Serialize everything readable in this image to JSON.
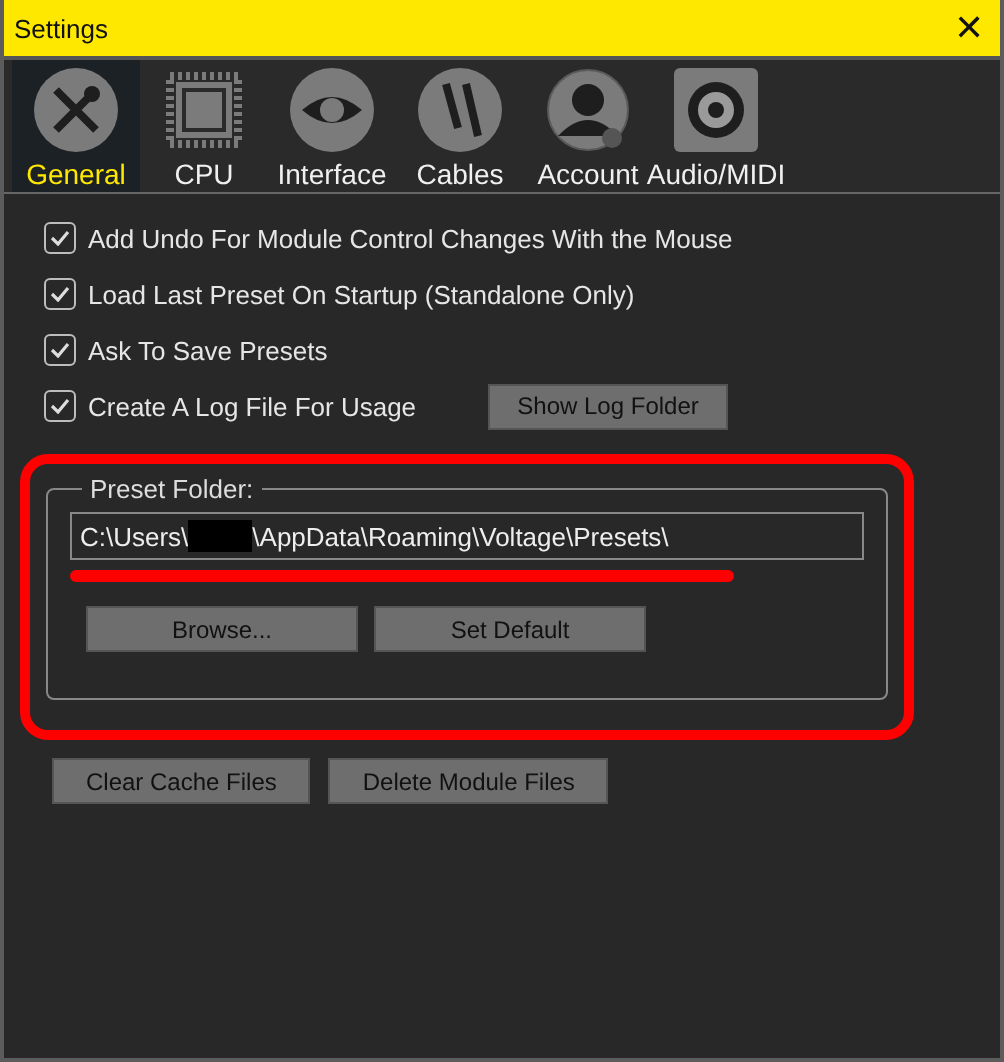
{
  "window": {
    "title": "Settings",
    "close": "✕"
  },
  "tabs": [
    {
      "label": "General",
      "selected": true
    },
    {
      "label": "CPU",
      "selected": false
    },
    {
      "label": "Interface",
      "selected": false
    },
    {
      "label": "Cables",
      "selected": false
    },
    {
      "label": "Account",
      "selected": false
    },
    {
      "label": "Audio/MIDI",
      "selected": false
    }
  ],
  "options": [
    {
      "label": "Add Undo For Module Control Changes With the Mouse",
      "checked": true
    },
    {
      "label": "Load Last Preset On Startup (Standalone Only)",
      "checked": true
    },
    {
      "label": "Ask To Save Presets",
      "checked": true
    },
    {
      "label": "Create A Log File For Usage",
      "checked": true,
      "button": "Show Log Folder"
    }
  ],
  "preset_folder": {
    "legend": "Preset Folder:",
    "path_start": "C:\\Users\\",
    "redacted": true,
    "highlighted": true,
    "path_underlined": true,
    "path_end": "\\AppData\\Roaming\\Voltage\\Presets\\",
    "buttons": [
      "Browse...",
      "Set Default"
    ]
  },
  "buttons": [
    "Clear Cache Files",
    "Delete Module Files"
  ]
}
